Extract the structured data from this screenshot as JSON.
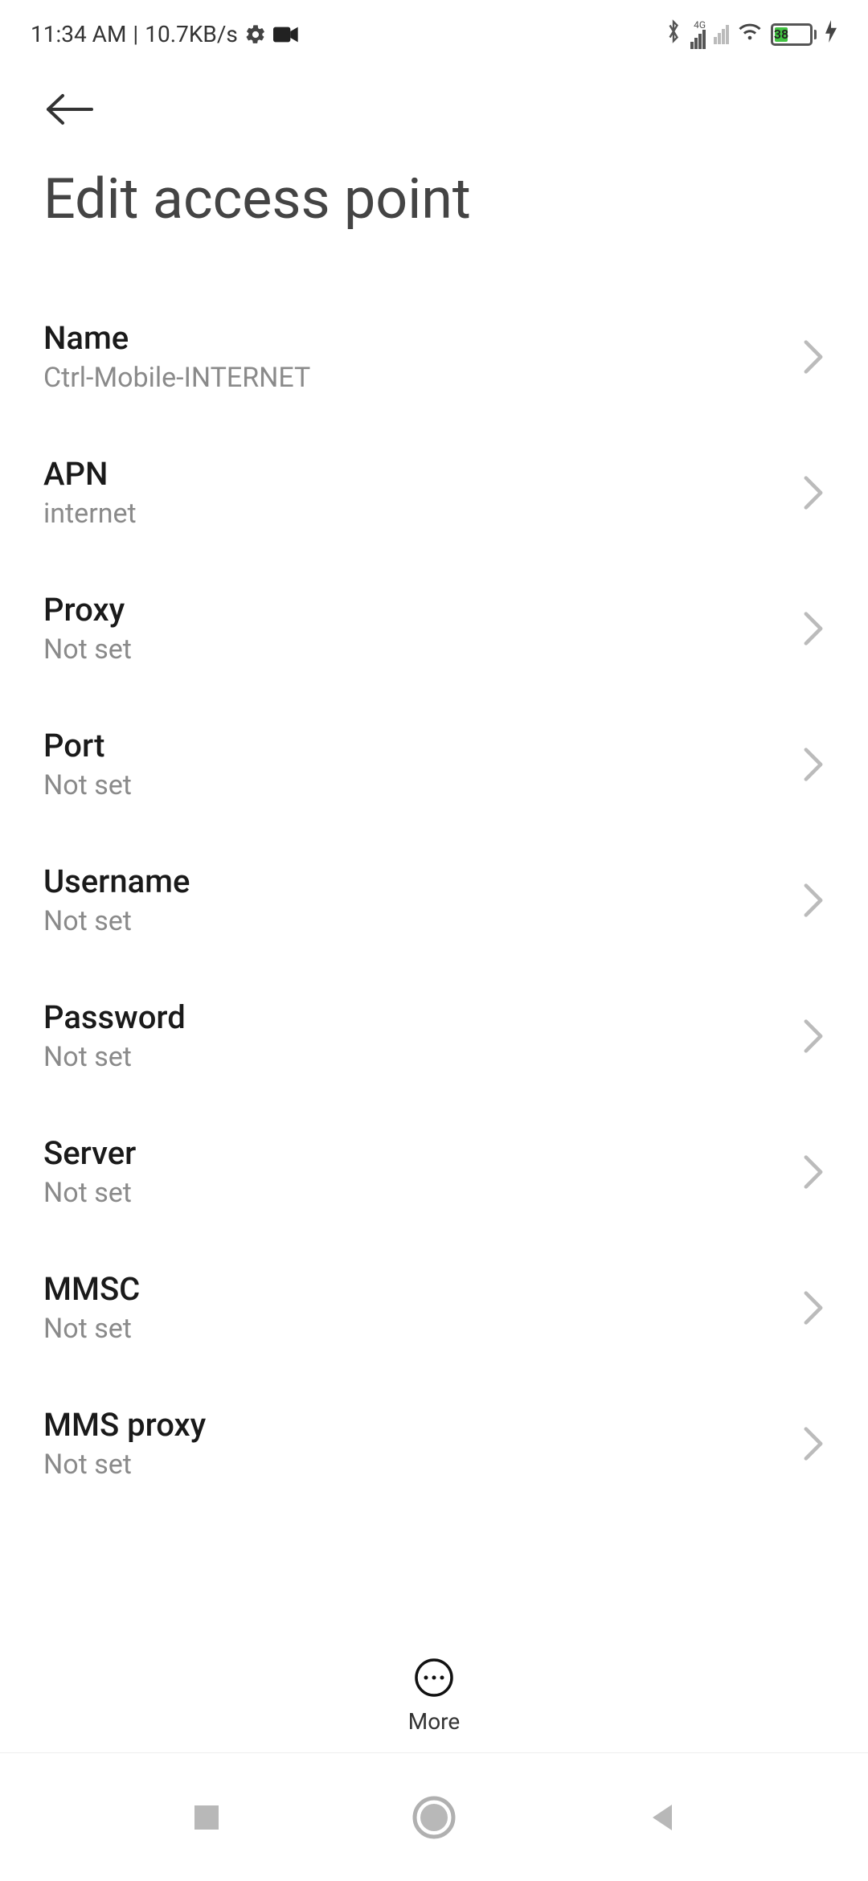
{
  "status_bar": {
    "time": "11:34 AM",
    "net_speed": "10.7KB/s",
    "battery_percent": "38",
    "battery_fill_pct": 38,
    "net_type": "4G"
  },
  "header": {
    "title": "Edit access point"
  },
  "rows": [
    {
      "label": "Name",
      "value": "Ctrl-Mobile-INTERNET"
    },
    {
      "label": "APN",
      "value": "internet"
    },
    {
      "label": "Proxy",
      "value": "Not set"
    },
    {
      "label": "Port",
      "value": "Not set"
    },
    {
      "label": "Username",
      "value": "Not set"
    },
    {
      "label": "Password",
      "value": "Not set"
    },
    {
      "label": "Server",
      "value": "Not set"
    },
    {
      "label": "MMSC",
      "value": "Not set"
    },
    {
      "label": "MMS proxy",
      "value": "Not set"
    }
  ],
  "footer": {
    "more_label": "More"
  }
}
